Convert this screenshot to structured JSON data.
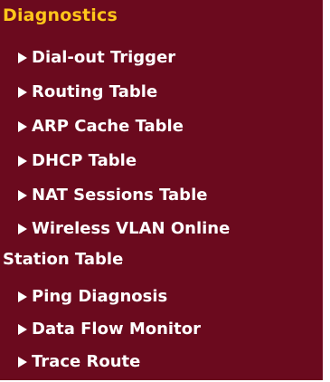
{
  "section": {
    "title": "Diagnostics"
  },
  "menu": {
    "items": [
      {
        "label": "Dial-out Trigger"
      },
      {
        "label": "Routing Table"
      },
      {
        "label": "ARP Cache Table"
      },
      {
        "label": "DHCP Table"
      },
      {
        "label": "NAT Sessions Table"
      },
      {
        "label": "Wireless VLAN Online",
        "label_line2": "Station Table"
      },
      {
        "label": "Ping Diagnosis"
      },
      {
        "label": "Data Flow Monitor"
      },
      {
        "label": "Trace Route"
      }
    ]
  },
  "colors": {
    "background": "#6b0a1e",
    "title": "#ffc61a",
    "item_text": "#ffffff"
  },
  "icons": {
    "item_bullet": "triangle-right-icon"
  }
}
